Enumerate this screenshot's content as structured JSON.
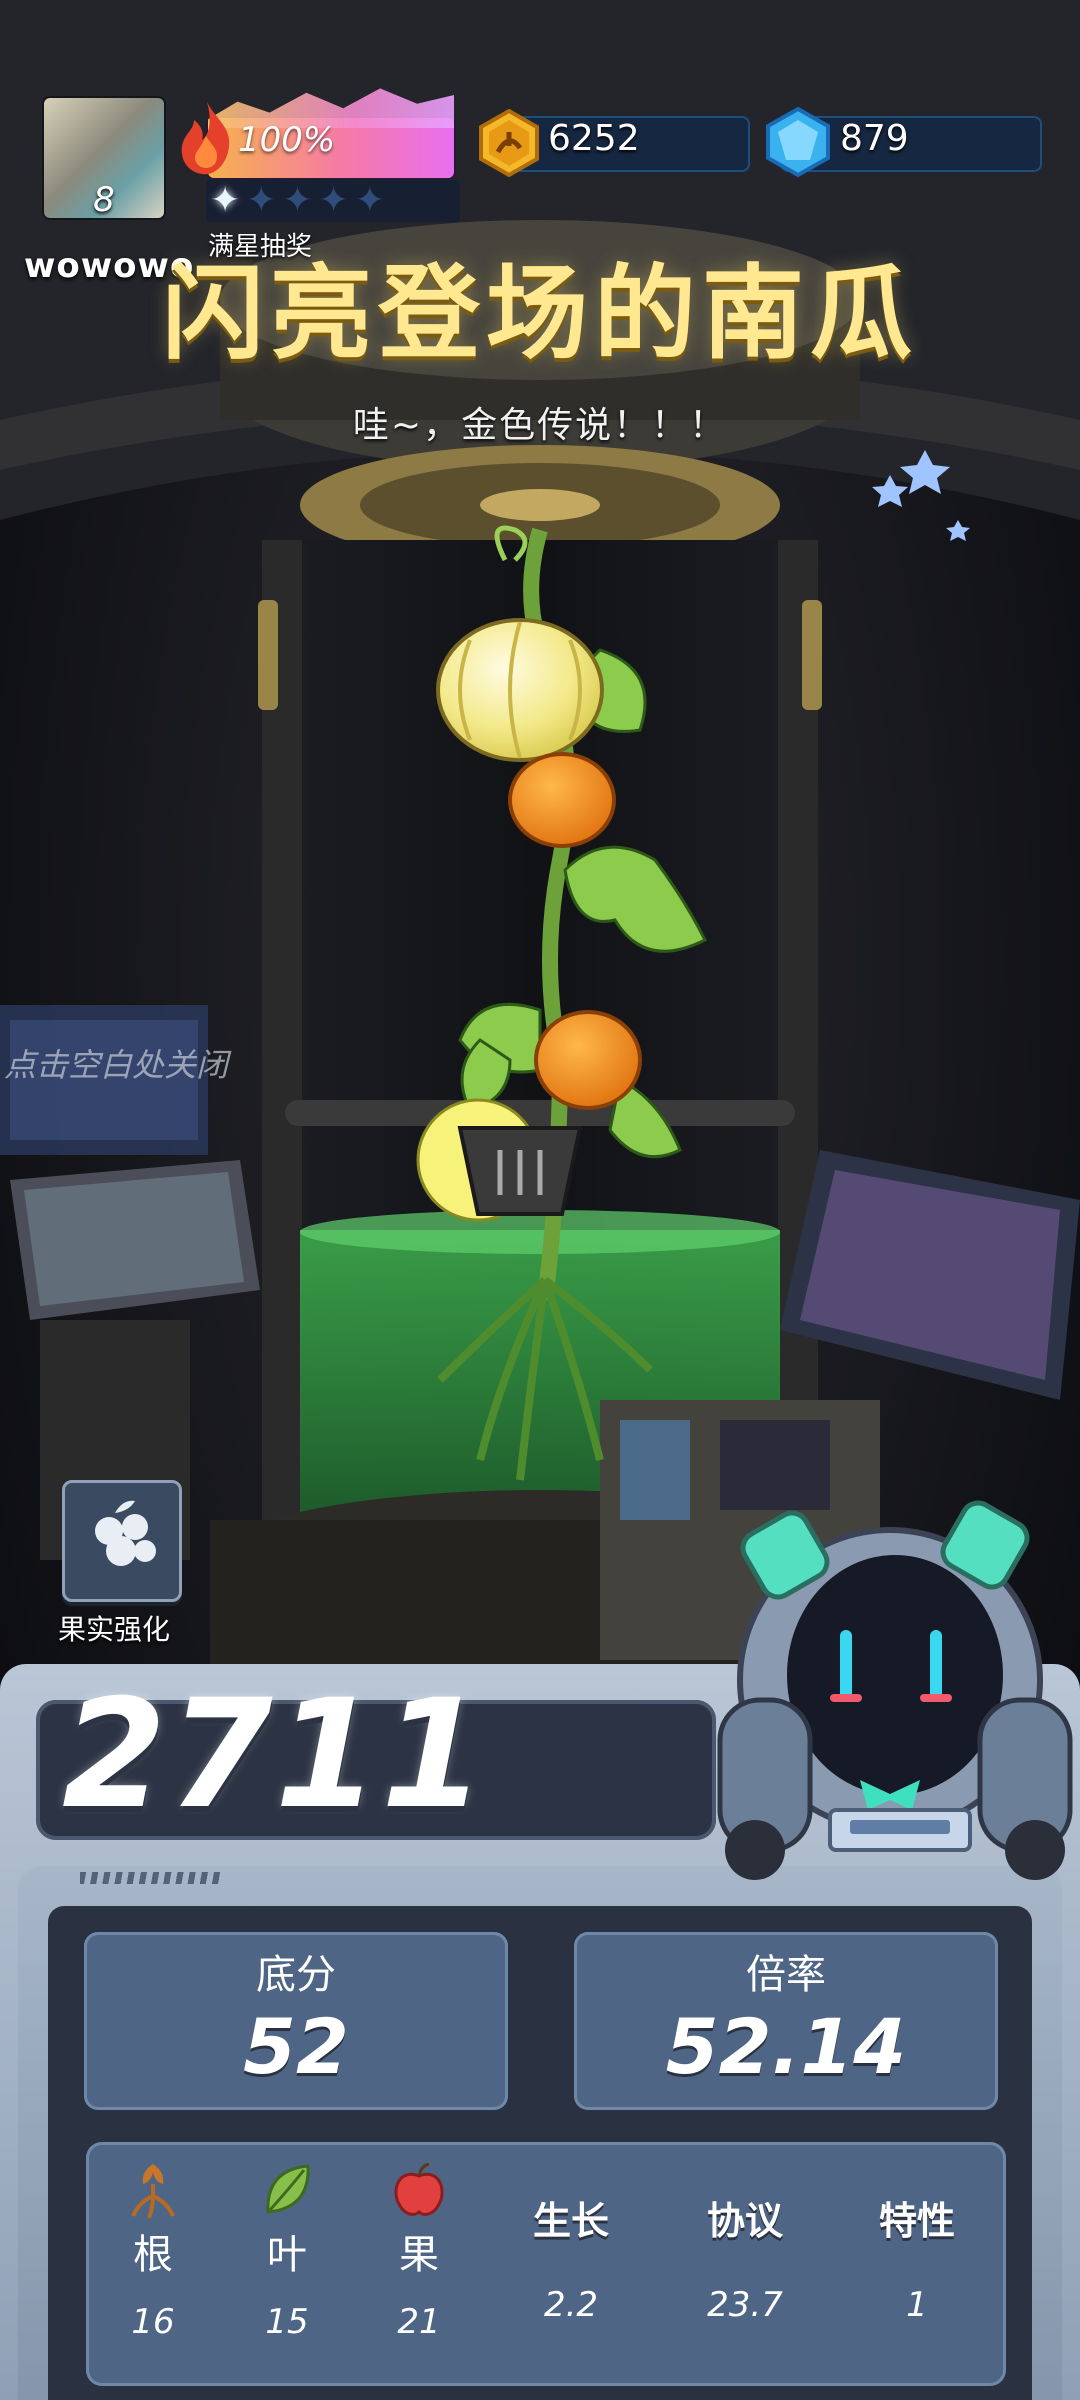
{
  "player": {
    "level": "8",
    "username": "wowowo"
  },
  "energy": {
    "percent_label": "100%",
    "stars_filled": 1,
    "stars_total": 5,
    "lottery_label": "满星抽奖"
  },
  "currencies": {
    "coins": "6252",
    "gems": "879"
  },
  "reveal": {
    "title": "闪亮登场的南瓜",
    "subtitle": "哇~，金色传说！！！",
    "close_hint": "点击空白处关闭"
  },
  "boost": {
    "label": "果实强化",
    "icon": "berry-cluster-icon"
  },
  "score": {
    "total": "2711",
    "base_label": "底分",
    "base_value": "52",
    "multiplier_label": "倍率",
    "multiplier_value": "52.14"
  },
  "attributes": [
    {
      "label": "根",
      "value": "16",
      "icon": "root-icon"
    },
    {
      "label": "叶",
      "value": "15",
      "icon": "leaf-icon"
    },
    {
      "label": "果",
      "value": "21",
      "icon": "apple-icon"
    },
    {
      "label": "生长",
      "value": "2.2"
    },
    {
      "label": "协议",
      "value": "23.7"
    },
    {
      "label": "特性",
      "value": "1"
    }
  ],
  "colors": {
    "title": "#ffe88f",
    "panel": "#4e6585",
    "panel_dark": "#2a3242",
    "energy_start": "#f7b14c",
    "energy_end": "#e86ff0"
  }
}
